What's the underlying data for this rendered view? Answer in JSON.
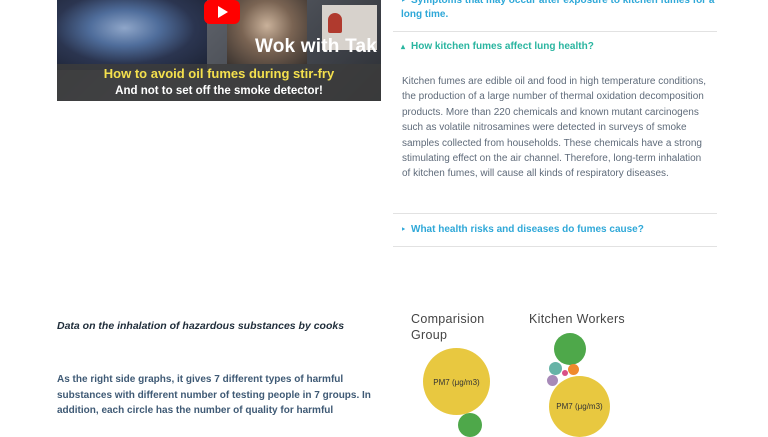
{
  "video": {
    "title": "Wok with Tak",
    "subtitle1": "How to avoid oil fumes during stir-fry",
    "subtitle2": "And not to set off the smoke detector!"
  },
  "accordion": {
    "items": [
      {
        "label": "Symptoms that may occur after exposure to kitchen fumes for a long time.",
        "expanded": false
      },
      {
        "label": "How kitchen fumes affect lung health?",
        "expanded": true,
        "body": "Kitchen fumes are edible oil and food in high temperature conditions, the production of a large number of thermal oxidation decomposition products. More than 220 chemicals and known mutant carcinogens such as volatile nitrosamines were detected in surveys of smoke samples collected from households. These chemicals have a strong stimulating effect on the air channel. Therefore, long-term inhalation of kitchen fumes, will cause all kinds of respiratory diseases."
      },
      {
        "label": "What health risks and diseases do fumes cause?",
        "expanded": false
      }
    ]
  },
  "section": {
    "title": "Data on the inhalation of hazardous substances by cooks",
    "text": "As the right side graphs, it gives 7 different types of harmful substances with different number of testing people in 7 groups. In addition, each circle has the number of quality for harmful"
  },
  "charts": {
    "comparison_title": "Comparision Group",
    "workers_title": "Kitchen Workers",
    "pm_label": "PM7 (μg/m3)"
  },
  "colors": {
    "accent_link": "#2fa8d8",
    "accent_active": "#2ab5a0",
    "bubble_yellow": "#e8c840",
    "bubble_green": "#4ea84a"
  }
}
